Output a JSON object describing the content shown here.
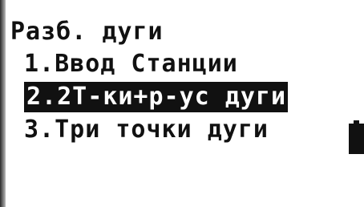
{
  "screen": {
    "title": "Разб. дуги",
    "menu": [
      {
        "label": "1.Ввод Станции"
      },
      {
        "label": "2.2Т-ки+р-ус дуги"
      },
      {
        "label": "3.Три точки дуги"
      }
    ],
    "selected_index": 1
  },
  "battery": {
    "icon": "battery-icon",
    "level": 1.0
  }
}
